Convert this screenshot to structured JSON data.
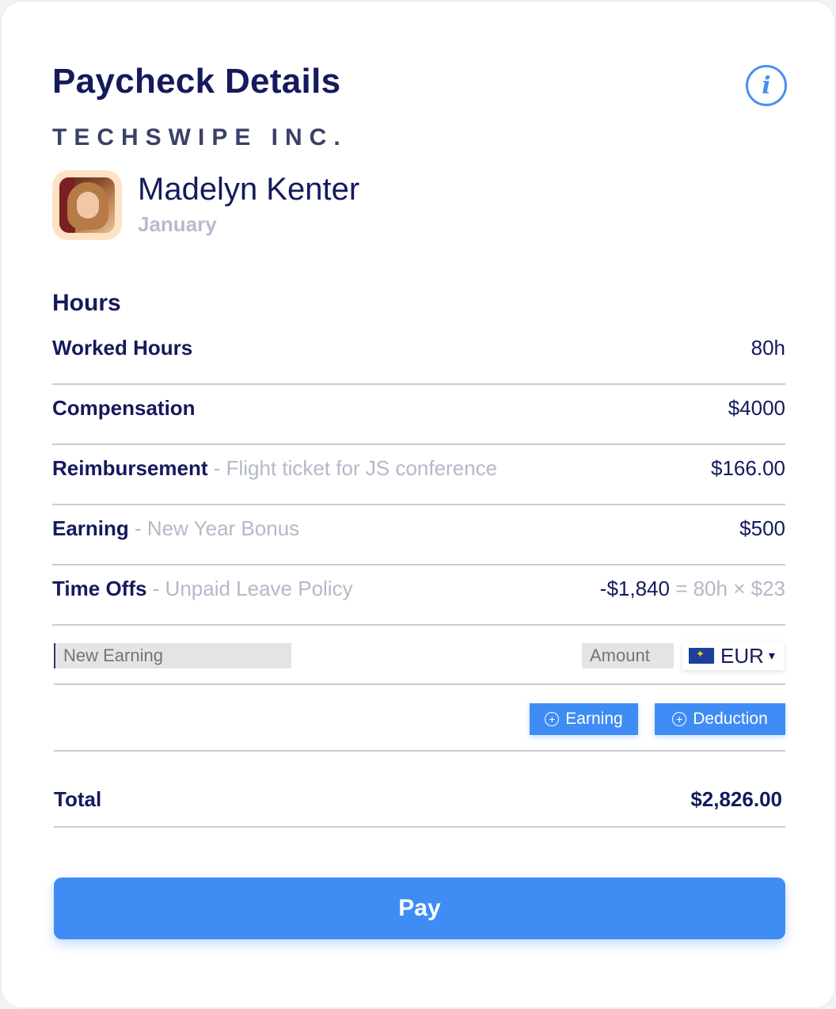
{
  "header": {
    "title": "Paycheck Details",
    "info_icon": "i",
    "company": "TECHSWIPE INC."
  },
  "employee": {
    "name": "Madelyn Kenter",
    "period": "January"
  },
  "hours_section": {
    "title": "Hours",
    "rows": [
      {
        "label": "Worked Hours",
        "sub": "",
        "value": "80h"
      },
      {
        "label": "Compensation",
        "sub": "",
        "value": "$4000"
      },
      {
        "label": "Reimbursement",
        "sub": " - Flight ticket for JS conference",
        "value": "$166.00"
      },
      {
        "label": "Earning",
        "sub": " - New Year Bonus",
        "value": "$500"
      },
      {
        "label": "Time Offs",
        "sub": " - Unpaid Leave Policy",
        "value": "-$1,840",
        "formula": " = 80h × $23"
      }
    ]
  },
  "new_item": {
    "earning_placeholder": "New Earning",
    "amount_placeholder": "Amount",
    "currency": "EUR",
    "currency_caret": "▾",
    "add_earning": "Earning",
    "add_deduction": "Deduction",
    "plus_glyph": "+"
  },
  "total": {
    "label": "Total",
    "value": "$2,826.00"
  },
  "pay_button": "Pay",
  "colors": {
    "accent": "#3f8cf5",
    "text": "#141a5c",
    "muted": "#b4b9c8"
  }
}
